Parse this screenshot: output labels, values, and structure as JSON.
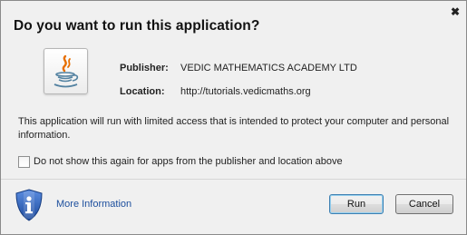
{
  "dialog": {
    "title": "Do you want to run this application?",
    "close_glyph": "✖"
  },
  "app_icon": "java-cup-icon",
  "info": {
    "publisher_label": "Publisher:",
    "publisher_value": "VEDIC MATHEMATICS ACADEMY LTD",
    "location_label": "Location:",
    "location_value": "http://tutorials.vedicmaths.org"
  },
  "description": "This application will run with limited access that is intended to protect your computer and personal information.",
  "checkbox": {
    "label": "Do not show this again for apps from the publisher and location above",
    "checked": false
  },
  "footer": {
    "more_info_label": "More Information",
    "info_icon": "shield-info-icon",
    "run_label": "Run",
    "cancel_label": "Cancel"
  },
  "colors": {
    "link": "#1c4e9d",
    "shield": "#2f5fb3",
    "java_orange": "#e76f00",
    "java_blue": "#5382a1"
  }
}
